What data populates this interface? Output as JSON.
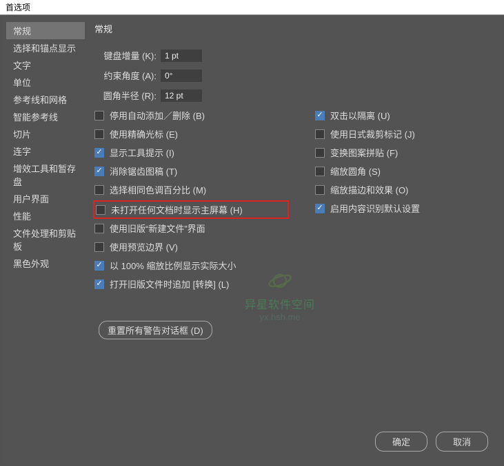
{
  "title": "首选项",
  "sidebar": {
    "items": [
      "常规",
      "选择和锚点显示",
      "文字",
      "单位",
      "参考线和网格",
      "智能参考线",
      "切片",
      "连字",
      "增效工具和暂存盘",
      "用户界面",
      "性能",
      "文件处理和剪贴板",
      "黑色外观"
    ],
    "selected": 0
  },
  "page": {
    "heading": "常规",
    "fields": {
      "keyboard_increment_label": "键盘增量 (K):",
      "keyboard_increment_value": "1 pt",
      "constrain_angle_label": "约束角度 (A):",
      "constrain_angle_value": "0°",
      "corner_radius_label": "圆角半径 (R):",
      "corner_radius_value": "12 pt"
    },
    "left_checks": [
      {
        "label": "停用自动添加／删除 (B)",
        "checked": false
      },
      {
        "label": "使用精确光标 (E)",
        "checked": false
      },
      {
        "label": "显示工具提示 (I)",
        "checked": true
      },
      {
        "label": "消除锯齿图稿 (T)",
        "checked": true
      },
      {
        "label": "选择相同色调百分比 (M)",
        "checked": false
      },
      {
        "label": "未打开任何文档时显示主屏幕 (H)",
        "checked": false,
        "highlight": true
      },
      {
        "label": "使用旧版“新建文件”界面",
        "checked": false
      },
      {
        "label": "使用预览边界 (V)",
        "checked": false
      },
      {
        "label": "以 100% 缩放比例显示实际大小",
        "checked": true
      },
      {
        "label": "打开旧版文件时追加 [转换] (L)",
        "checked": true
      }
    ],
    "right_checks": [
      {
        "label": "双击以隔离 (U)",
        "checked": true
      },
      {
        "label": "使用日式裁剪标记 (J)",
        "checked": false
      },
      {
        "label": "变换图案拼贴 (F)",
        "checked": false
      },
      {
        "label": "缩放圆角 (S)",
        "checked": false
      },
      {
        "label": "缩放描边和效果 (O)",
        "checked": false
      },
      {
        "label": "启用内容识别默认设置",
        "checked": true
      }
    ],
    "reset_btn": "重置所有警告对话框 (D)"
  },
  "footer": {
    "ok": "确定",
    "cancel": "取消"
  },
  "watermark": {
    "line1": "异星软件空间",
    "line2": "yx.hsh.me"
  }
}
